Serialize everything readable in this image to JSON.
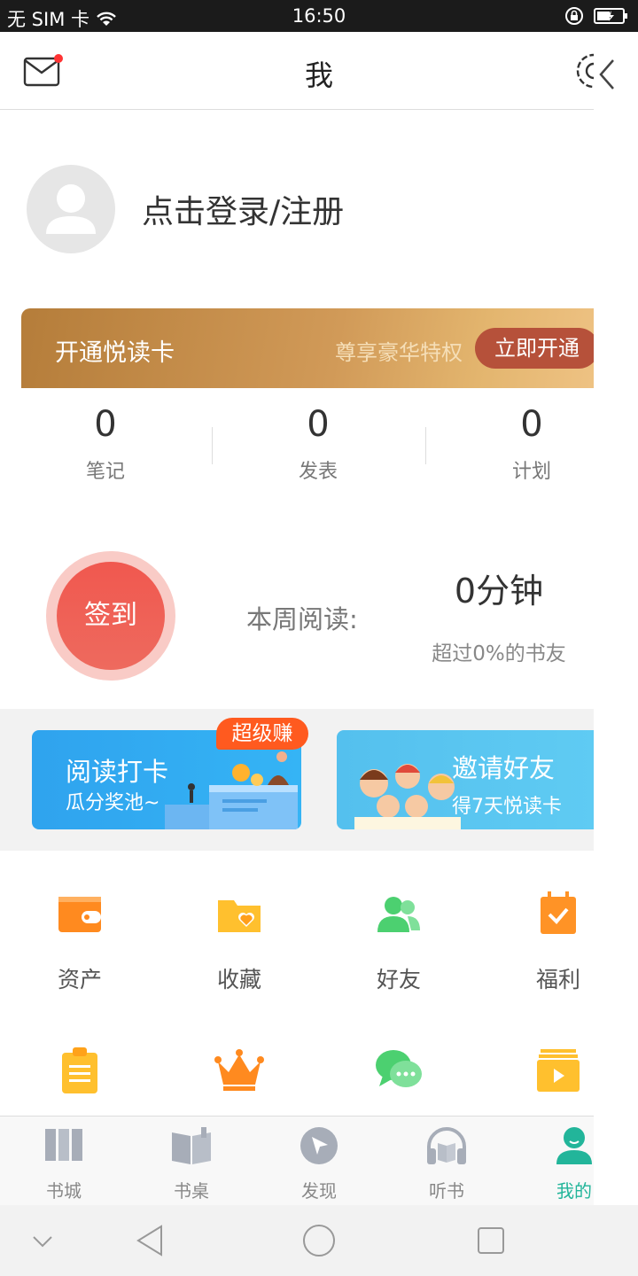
{
  "status_bar": {
    "carrier": "无 SIM 卡",
    "time": "16:50"
  },
  "header": {
    "title": "我"
  },
  "profile": {
    "login_text": "点击登录/注册"
  },
  "vip_card": {
    "name": "开通悦读卡",
    "privilege": "尊享豪华特权",
    "button": "立即开通"
  },
  "stats": [
    {
      "value": "0",
      "label": "笔记"
    },
    {
      "value": "0",
      "label": "发表"
    },
    {
      "value": "0",
      "label": "计划"
    }
  ],
  "checkin": {
    "button": "签到",
    "week_label": "本周阅读:",
    "week_value": "0分钟",
    "week_sub": "超过0%的书友"
  },
  "banners": {
    "tag": "超级赚",
    "left": {
      "title": "阅读打卡",
      "subtitle": "瓜分奖池~"
    },
    "right": {
      "title": "邀请好友",
      "subtitle": "得7天悦读卡"
    }
  },
  "grid": [
    {
      "label": "资产",
      "icon": "wallet-icon",
      "color": "#ff8a1f"
    },
    {
      "label": "收藏",
      "icon": "folder-heart-icon",
      "color": "#ffc02e"
    },
    {
      "label": "好友",
      "icon": "friends-icon",
      "color": "#4cd070"
    },
    {
      "label": "福利",
      "icon": "calendar-check-icon",
      "color": "#ff9326"
    },
    {
      "label": "",
      "icon": "clipboard-icon",
      "color": "#ffc02e"
    },
    {
      "label": "",
      "icon": "crown-icon",
      "color": "#ff8a1f"
    },
    {
      "label": "",
      "icon": "chat-icon",
      "color": "#4cd070"
    },
    {
      "label": "",
      "icon": "video-stack-icon",
      "color": "#ffc02e"
    }
  ],
  "tabbar": [
    {
      "label": "书城",
      "icon": "bookstore-icon",
      "active": false
    },
    {
      "label": "书桌",
      "icon": "book-desk-icon",
      "active": false
    },
    {
      "label": "发现",
      "icon": "discover-icon",
      "active": false
    },
    {
      "label": "听书",
      "icon": "headphones-icon",
      "active": false
    },
    {
      "label": "我的",
      "icon": "profile-icon",
      "active": true
    }
  ],
  "colors": {
    "accent": "#22b59a",
    "checkin": "#f0584f",
    "vip_button": "#b6513a"
  }
}
